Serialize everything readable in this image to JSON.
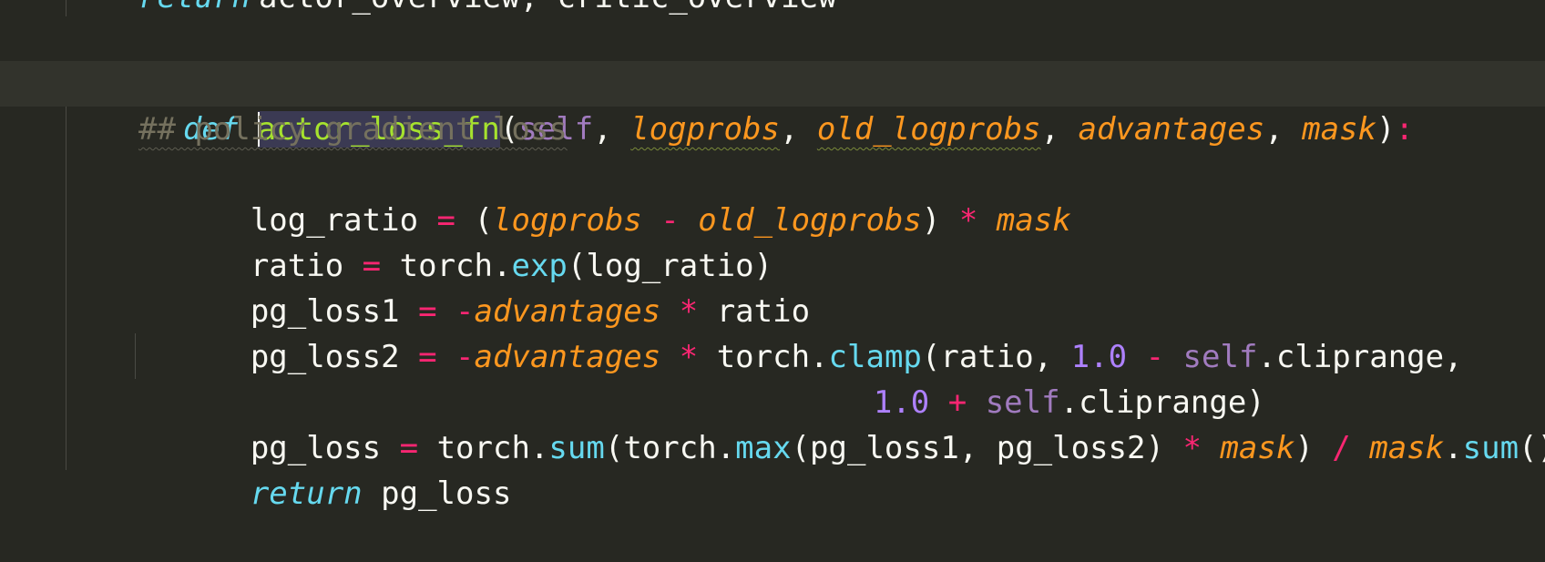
{
  "editor": {
    "top_line": "return actor_overview, critic_overview",
    "def_line": {
      "keyword": "def",
      "function_name": "actor_loss_fn",
      "open_paren": "(",
      "self": "self",
      "comma": ", ",
      "p1": "logprobs",
      "p2": "old_logprobs",
      "p3": "advantages",
      "p4": "mask",
      "close_paren": ")",
      "colon": ":"
    },
    "comment": "## policy gradient loss",
    "l_log_ratio": {
      "name": "log_ratio",
      "eq": "=",
      "open": "(",
      "a": "logprobs",
      "minus": "-",
      "b": "old_logprobs",
      "close": ")",
      "mul": "*",
      "mask": "mask"
    },
    "l_ratio": {
      "name": "ratio",
      "eq": "=",
      "obj": "torch",
      "dot": ".",
      "fn": "exp",
      "args": "(log_ratio)"
    },
    "l_pg1": {
      "name": "pg_loss1",
      "eq": "=",
      "neg": "-",
      "adv": "advantages",
      "mul": "*",
      "ratio": "ratio"
    },
    "l_pg2": {
      "name": "pg_loss2",
      "eq": "=",
      "neg": "-",
      "adv": "advantages",
      "mul": "*",
      "obj": "torch",
      "dot": ".",
      "fn": "clamp",
      "open": "(ratio, ",
      "num": "1.0",
      "minus": "-",
      "self": "self",
      "attr": ".cliprange,"
    },
    "l_pg2_cont": {
      "num": "1.0",
      "plus": "+",
      "self": "self",
      "attr": ".cliprange)"
    },
    "l_pg_loss": {
      "name": "pg_loss",
      "eq": "=",
      "obj1": "torch",
      "dot": ".",
      "fn1": "sum",
      "open1": "(torch.",
      "fn2": "max",
      "args2": "(pg_loss1, pg_loss2)",
      "mul": "*",
      "mask1": "mask",
      "close1": ")",
      "div": "/",
      "mask2": "mask",
      "fn3": "sum",
      "call3": "()"
    },
    "l_return": {
      "keyword": "return",
      "value": "pg_loss"
    }
  },
  "colors": {
    "background": "#272822",
    "current_line": "#32332c",
    "keyword": "#66d9ef",
    "function": "#a6e22e",
    "param": "#fd971f",
    "operator": "#f92672",
    "number": "#ae81ff",
    "comment": "#75715e",
    "bulb": "#e6b422"
  },
  "icons": {
    "intention_bulb": "lightbulb-icon"
  }
}
